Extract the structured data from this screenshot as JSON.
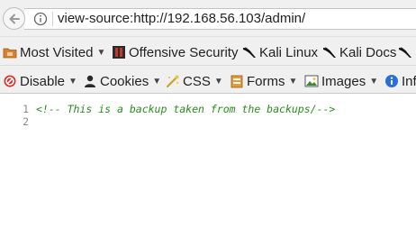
{
  "address_bar": {
    "url": "view-source:http://192.168.56.103/admin/"
  },
  "bookmarks": [
    {
      "label": "Most Visited",
      "icon": "folder-icon",
      "dropdown": true
    },
    {
      "label": "Offensive Security",
      "icon": "offsec-icon",
      "dropdown": false
    },
    {
      "label": "Kali Linux",
      "icon": "kali-dragon-icon",
      "dropdown": false
    },
    {
      "label": "Kali Docs",
      "icon": "kali-dragon-icon",
      "dropdown": false
    }
  ],
  "webdev_toolbar": [
    {
      "label": "Disable",
      "icon": "disable-icon"
    },
    {
      "label": "Cookies",
      "icon": "cookies-icon"
    },
    {
      "label": "CSS",
      "icon": "css-icon"
    },
    {
      "label": "Forms",
      "icon": "forms-icon"
    },
    {
      "label": "Images",
      "icon": "images-icon"
    },
    {
      "label": "Inf",
      "icon": "info-icon"
    }
  ],
  "source": {
    "lines": [
      {
        "number": "1",
        "text": "<!-- This is a backup taken from the backups/-->"
      },
      {
        "number": "2",
        "text": ""
      }
    ]
  },
  "colors": {
    "comment": "#2a8c1e",
    "line_number": "#8a8a8a",
    "toolbar_bg": "#f0f0f0"
  }
}
